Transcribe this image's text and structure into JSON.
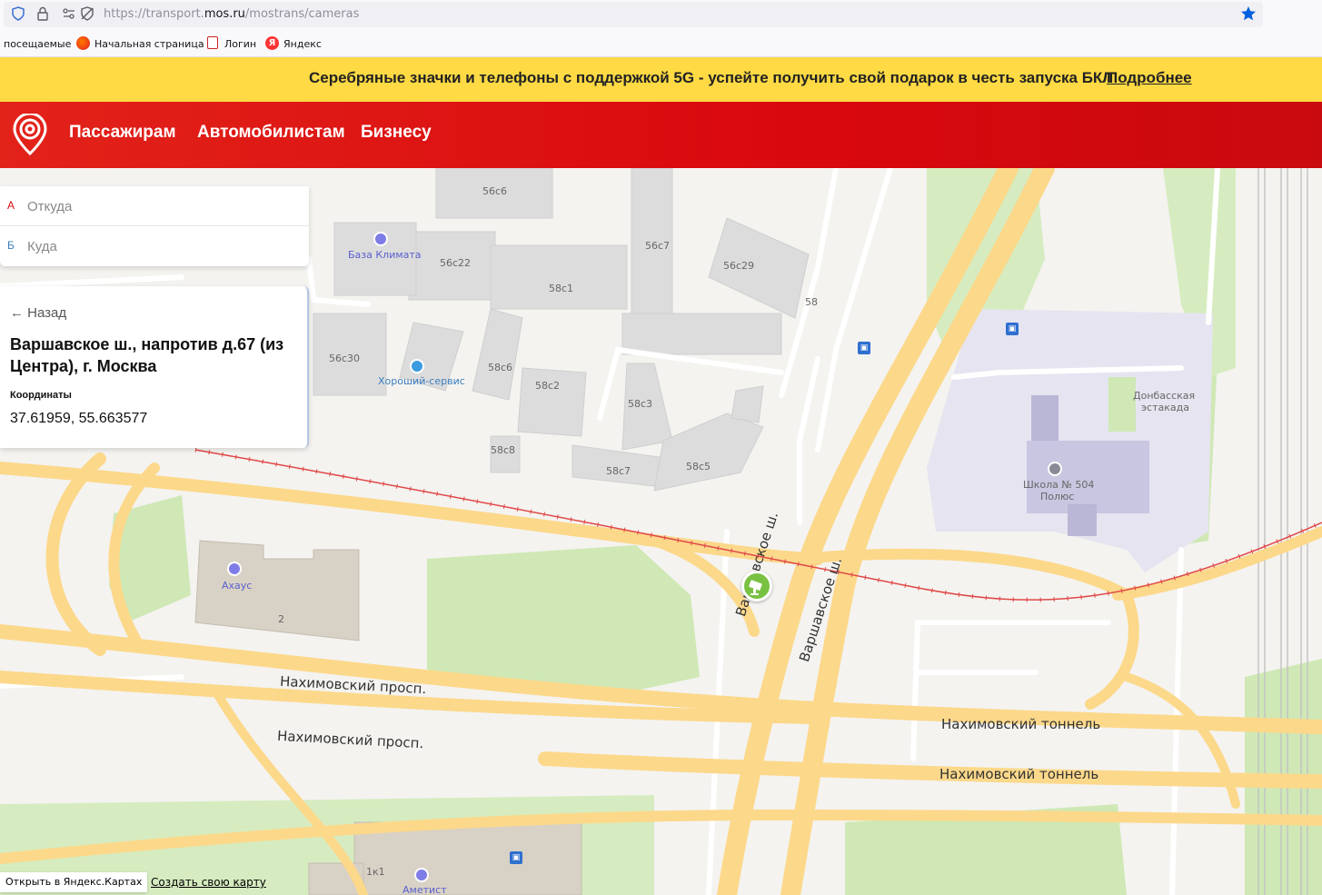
{
  "browser": {
    "url_prefix": "https://transport.",
    "url_domain": "mos.ru",
    "url_path": "/mostrans/cameras",
    "bookmarks": [
      {
        "label": "посещаемые"
      },
      {
        "label": "Начальная страница"
      },
      {
        "label": "Логин"
      },
      {
        "label": "Яндекс"
      }
    ]
  },
  "promo": {
    "text": "Серебряные значки и телефоны с поддержкой 5G - успейте получить свой подарок в честь запуска БКЛ",
    "link": "Подробнее"
  },
  "header": {
    "nav": [
      "Пассажирам",
      "Автомобилистам",
      "Бизнесу"
    ]
  },
  "route": {
    "from_mark": "А",
    "from_placeholder": "Откуда",
    "to_mark": "Б",
    "to_placeholder": "Куда"
  },
  "card": {
    "back": "← Назад",
    "title": "Варшавское ш., напротив д.67 (из Центра), г. Москва",
    "coord_label": "Координаты",
    "coord_value": "37.61959, 55.663577"
  },
  "map": {
    "buildings": [
      "56с6",
      "56с7",
      "56с22",
      "58с1",
      "56с29",
      "58",
      "56с30",
      "58с6",
      "58с2",
      "58с3",
      "58с8",
      "58с7",
      "58с5",
      "2",
      "1к1"
    ],
    "pois": {
      "baza": "База Климата",
      "horoshiy": "Хороший-сервис",
      "axaus": "Ахаус",
      "ametist": "Аметист",
      "school_line1": "Школа № 504",
      "school_line2": "Полюс",
      "donbass_line1": "Донбасская",
      "donbass_line2": "эстакада"
    },
    "roads": {
      "nakh1": "Нахимовский просп.",
      "nakh2": "Нахимовский просп.",
      "tunnel1": "Нахимовский тоннель",
      "tunnel2": "Нахимовский тоннель",
      "varsh1": "Варшавское ш.",
      "varsh2": "Варшавское ш."
    },
    "open_in_yandex": "Открыть в Яндекс.Картах",
    "create_map": "Создать свою карту"
  },
  "colors": {
    "brand_red": "#d9080d",
    "promo_yellow": "#ffda44",
    "camera_green": "#79c142",
    "road_yellow": "#fcd88a"
  }
}
